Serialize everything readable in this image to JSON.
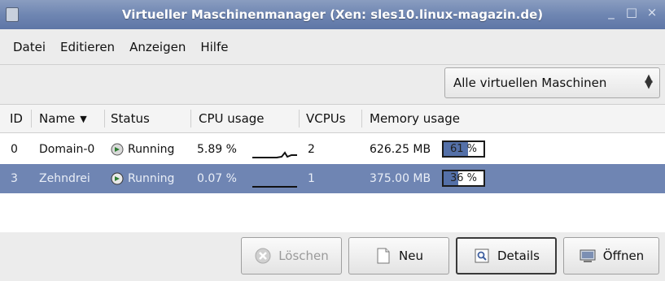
{
  "window": {
    "title": "Virtueller Maschinenmanager (Xen: sles10.linux-magazin.de)",
    "controls": [
      "_",
      "□",
      "×"
    ]
  },
  "menu": [
    "Datei",
    "Editieren",
    "Anzeigen",
    "Hilfe"
  ],
  "filter": {
    "selected": "Alle virtuellen Maschinen"
  },
  "columns": {
    "id": "ID",
    "name": "Name",
    "status": "Status",
    "cpu": "CPU usage",
    "vcpus": "VCPUs",
    "memory": "Memory usage"
  },
  "rows": [
    {
      "id": "0",
      "name": "Domain-0",
      "status": "Running",
      "cpu": "5.89 %",
      "vcpus": "2",
      "memory": "626.25 MB",
      "mem_pct": 61,
      "mem_label": "61 %",
      "selected": false
    },
    {
      "id": "3",
      "name": "Zehndrei",
      "status": "Running",
      "cpu": "0.07 %",
      "vcpus": "1",
      "memory": "375.00 MB",
      "mem_pct": 36,
      "mem_label": "36 %",
      "selected": true
    }
  ],
  "buttons": {
    "delete": "Löschen",
    "new": "Neu",
    "details": "Details",
    "open": "Öffnen"
  },
  "colors": {
    "selection": "#6f85b3",
    "titlebar": "#6f86b2",
    "membar_fill": "#5470a8"
  }
}
